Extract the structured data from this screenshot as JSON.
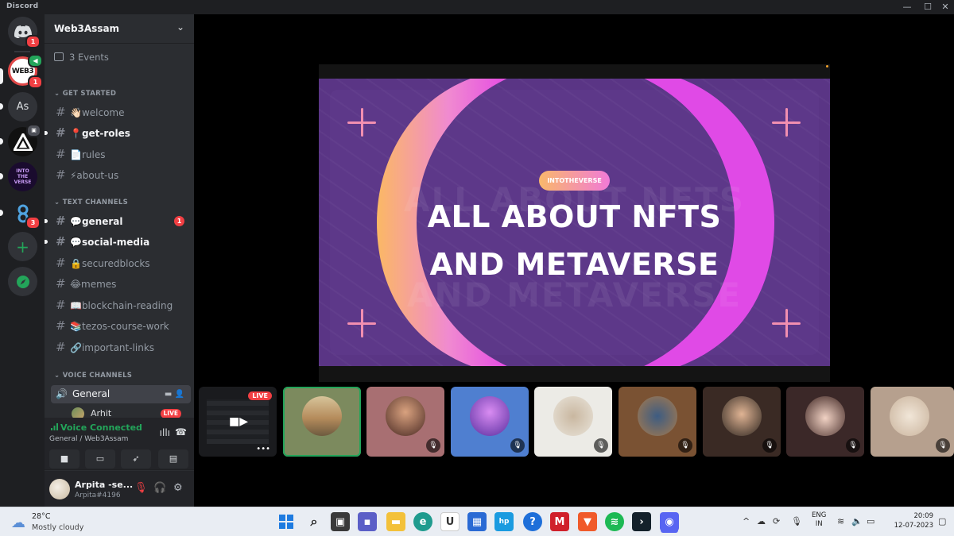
{
  "window": {
    "title": "Discord"
  },
  "rail": {
    "home_badge": "1",
    "web3_badge": "1",
    "as_label": "As",
    "verse_label": "INTO THE VERSE",
    "chain_badge": "3"
  },
  "server": {
    "name": "Web3Assam",
    "events": "3 Events"
  },
  "categories": {
    "get_started": "GET STARTED",
    "text_channels": "TEXT CHANNELS",
    "voice_channels": "VOICE CHANNELS"
  },
  "channels": {
    "welcome": "👋🏻welcome",
    "get_roles": "📍get-roles",
    "rules": "📄rules",
    "about_us": "⚡about-us",
    "general": "💬general",
    "general_count": "1",
    "social_media": "💬social-media",
    "securedblocks": "🔒securedblocks",
    "memes": "😂memes",
    "blockchain_reading": "📖blockchain-reading",
    "tezos_course_work": "📚tezos-course-work",
    "important_links": "🔗important-links"
  },
  "voice": {
    "channel": "General",
    "user": "Arhit",
    "live": "LIVE",
    "status": "Voice Connected",
    "location": "General / Web3Assam"
  },
  "user": {
    "name": "Arpita -se...",
    "tag": "Arpita#4196"
  },
  "slide": {
    "pill": "INTOTHEVERSE",
    "line1": "ALL ABOUT NFTS",
    "line2": "AND METAVERSE"
  },
  "tiles": {
    "live": "LIVE"
  },
  "taskbar": {
    "temp": "28°C",
    "weather": "Mostly cloudy",
    "lang1": "ENG",
    "lang2": "IN",
    "time": "20:09",
    "date": "12-07-2023"
  },
  "colors": {
    "accent_green": "#23a55a",
    "notify_red": "#f23f43",
    "blurple": "#5865f2"
  }
}
